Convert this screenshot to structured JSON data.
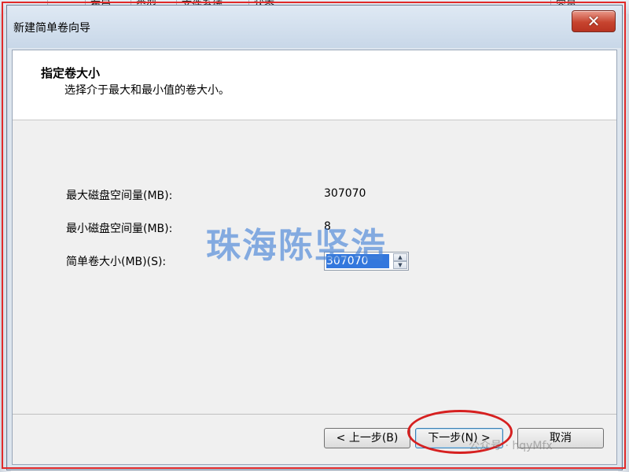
{
  "background": {
    "columns": [
      "",
      "布局",
      "类型",
      "文件系统",
      "状态",
      "容量"
    ]
  },
  "dialog": {
    "title": "新建简单卷向导",
    "close_icon": "close-icon"
  },
  "header": {
    "title": "指定卷大小",
    "subtitle": "选择介于最大和最小值的卷大小。"
  },
  "fields": {
    "max_label": "最大磁盘空间量(MB):",
    "max_value": "307070",
    "min_label": "最小磁盘空间量(MB):",
    "min_value": "8",
    "size_label": "简单卷大小(MB)(S):",
    "size_value": "307070"
  },
  "watermark": "珠海陈坚浩",
  "buttons": {
    "back": "< 上一步(B)",
    "next": "下一步(N) >",
    "cancel": "取消"
  },
  "footer_watermark": "公众号 · hqyMfx",
  "colors": {
    "annotation_red": "#e02a2a",
    "selection_blue": "#3377dd"
  }
}
